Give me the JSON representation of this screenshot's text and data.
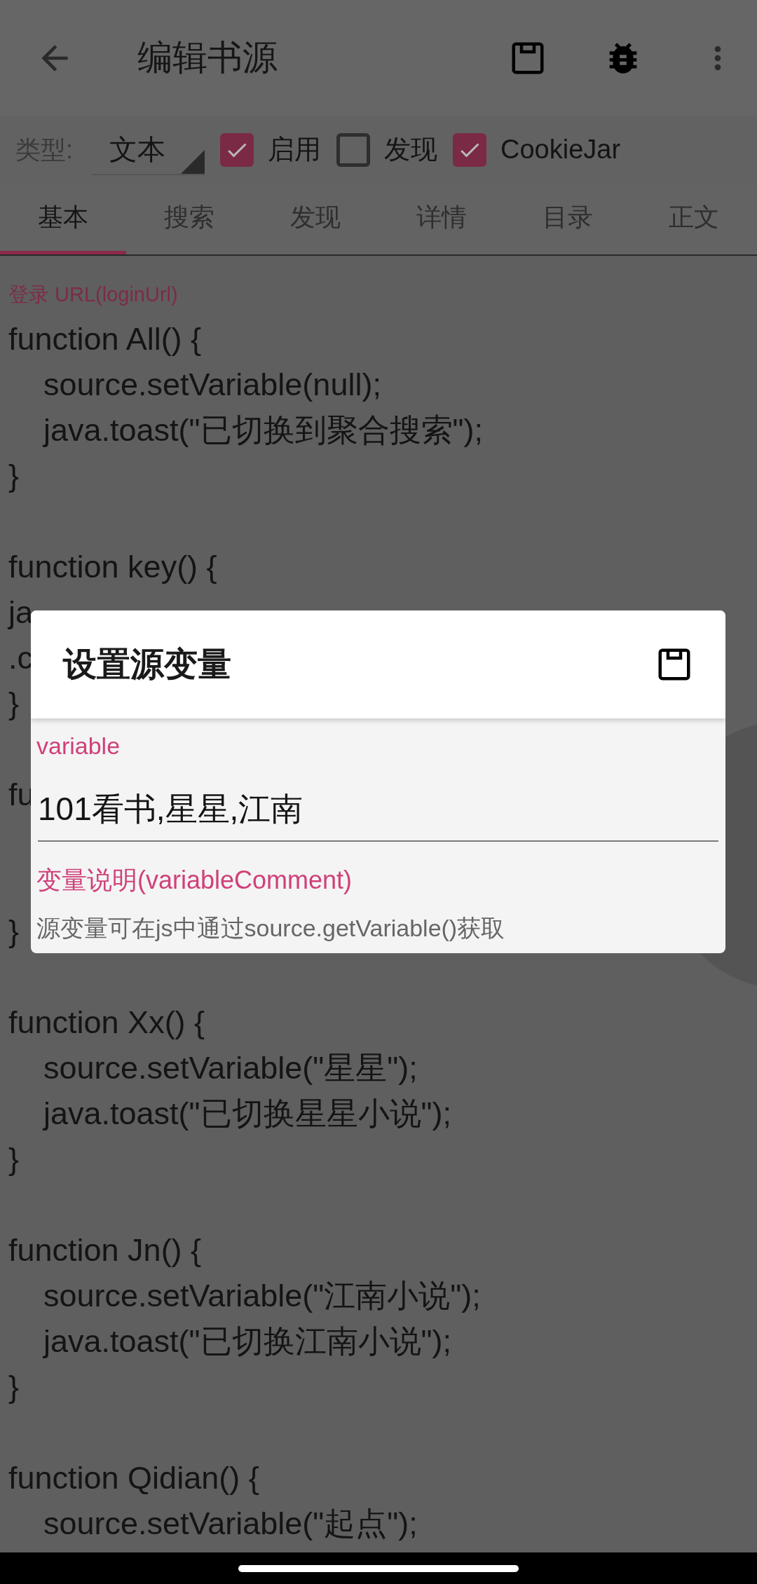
{
  "toolbar": {
    "title": "编辑书源"
  },
  "options": {
    "type_label": "类型:",
    "type_value": "文本",
    "checkboxes": [
      {
        "label": "启用",
        "checked": true
      },
      {
        "label": "发现",
        "checked": false
      },
      {
        "label": "CookieJar",
        "checked": true
      }
    ]
  },
  "tabs": [
    {
      "label": "基本",
      "selected": true
    },
    {
      "label": "搜索",
      "selected": false
    },
    {
      "label": "发现",
      "selected": false
    },
    {
      "label": "详情",
      "selected": false
    },
    {
      "label": "目录",
      "selected": false
    },
    {
      "label": "正文",
      "selected": false
    }
  ],
  "field_label": "登录 URL(loginUrl)",
  "code_lines": [
    {
      "kind": "code",
      "text": "function All() {"
    },
    {
      "kind": "code",
      "text": "    source.setVariable(null);"
    },
    {
      "kind": "code",
      "text": "    java.toast(\"已切换到聚合搜索\");"
    },
    {
      "kind": "code",
      "text": "}"
    },
    {
      "kind": "blank"
    },
    {
      "kind": "code",
      "text": "function key() {"
    },
    {
      "kind": "code",
      "text": "ja"
    },
    {
      "kind": "code",
      "text": ".c"
    },
    {
      "kind": "code",
      "text": "}"
    },
    {
      "kind": "blank"
    },
    {
      "kind": "code",
      "text": "fu"
    },
    {
      "kind": "blank"
    },
    {
      "kind": "blank"
    },
    {
      "kind": "code",
      "text": "}"
    },
    {
      "kind": "blank"
    },
    {
      "kind": "code",
      "text": "function Xx() {"
    },
    {
      "kind": "code",
      "text": "    source.setVariable(\"星星\");"
    },
    {
      "kind": "code",
      "text": "    java.toast(\"已切换星星小说\");"
    },
    {
      "kind": "code",
      "text": "}"
    },
    {
      "kind": "blank"
    },
    {
      "kind": "code",
      "text": "function Jn() {"
    },
    {
      "kind": "code",
      "text": "    source.setVariable(\"江南小说\");"
    },
    {
      "kind": "code",
      "text": "    java.toast(\"已切换江南小说\");"
    },
    {
      "kind": "code",
      "text": "}"
    },
    {
      "kind": "blank"
    },
    {
      "kind": "code",
      "text": "function Qidian() {"
    },
    {
      "kind": "code",
      "text": "    source.setVariable(\"起点\");"
    }
  ],
  "dialog": {
    "title": "设置源变量",
    "variable_label": "variable",
    "variable_value": "101看书,星星,江南",
    "comment_label": "变量说明(variableComment)",
    "comment_text": "源变量可在js中通过source.getVariable()获取"
  }
}
